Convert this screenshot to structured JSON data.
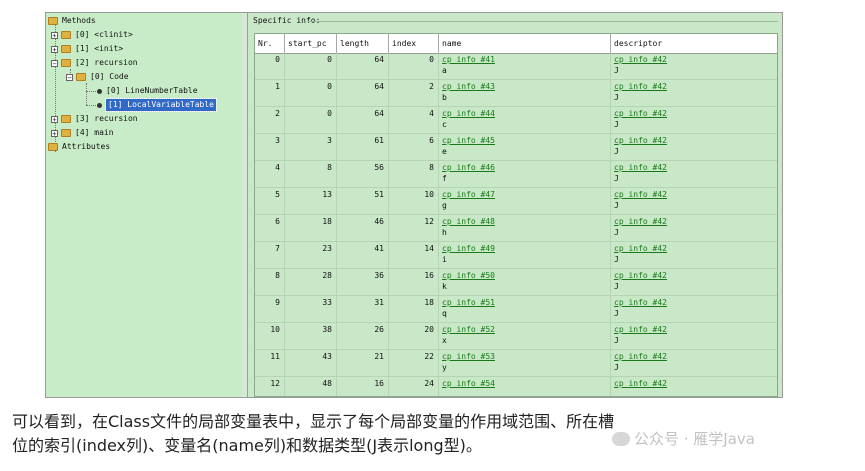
{
  "tree": {
    "methods_label": "Methods",
    "clinit_label": "[0] <clinit>",
    "init_label": "[1] <init>",
    "recursion2_label": "[2] recursion",
    "code_label": "[0] Code",
    "lnt_label": "[0] LineNumberTable",
    "lvt_label": "[1] LocalVariableTable",
    "recursion3_label": "[3] recursion",
    "main_label": "[4] main",
    "attributes_label": "Attributes",
    "collapsed_glyph": "+",
    "expanded_glyph": "−"
  },
  "panel": {
    "title": "Specific info:"
  },
  "table": {
    "columns": [
      "Nr.",
      "start_pc",
      "length",
      "index",
      "name",
      "descriptor"
    ],
    "rows": [
      {
        "nr": "0",
        "start_pc": "0",
        "length": "64",
        "index": "0",
        "name_ref": "cp info #41",
        "name": "a",
        "desc_ref": "cp info #42",
        "desc": "J"
      },
      {
        "nr": "1",
        "start_pc": "0",
        "length": "64",
        "index": "2",
        "name_ref": "cp info #43",
        "name": "b",
        "desc_ref": "cp info #42",
        "desc": "J"
      },
      {
        "nr": "2",
        "start_pc": "0",
        "length": "64",
        "index": "4",
        "name_ref": "cp info #44",
        "name": "c",
        "desc_ref": "cp info #42",
        "desc": "J"
      },
      {
        "nr": "3",
        "start_pc": "3",
        "length": "61",
        "index": "6",
        "name_ref": "cp info #45",
        "name": "e",
        "desc_ref": "cp info #42",
        "desc": "J"
      },
      {
        "nr": "4",
        "start_pc": "8",
        "length": "56",
        "index": "8",
        "name_ref": "cp info #46",
        "name": "f",
        "desc_ref": "cp info #42",
        "desc": "J"
      },
      {
        "nr": "5",
        "start_pc": "13",
        "length": "51",
        "index": "10",
        "name_ref": "cp info #47",
        "name": "g",
        "desc_ref": "cp info #42",
        "desc": "J"
      },
      {
        "nr": "6",
        "start_pc": "18",
        "length": "46",
        "index": "12",
        "name_ref": "cp info #48",
        "name": "h",
        "desc_ref": "cp info #42",
        "desc": "J"
      },
      {
        "nr": "7",
        "start_pc": "23",
        "length": "41",
        "index": "14",
        "name_ref": "cp info #49",
        "name": "i",
        "desc_ref": "cp info #42",
        "desc": "J"
      },
      {
        "nr": "8",
        "start_pc": "28",
        "length": "36",
        "index": "16",
        "name_ref": "cp info #50",
        "name": "k",
        "desc_ref": "cp info #42",
        "desc": "J"
      },
      {
        "nr": "9",
        "start_pc": "33",
        "length": "31",
        "index": "18",
        "name_ref": "cp info #51",
        "name": "q",
        "desc_ref": "cp info #42",
        "desc": "J"
      },
      {
        "nr": "10",
        "start_pc": "38",
        "length": "26",
        "index": "20",
        "name_ref": "cp info #52",
        "name": "x",
        "desc_ref": "cp info #42",
        "desc": "J"
      },
      {
        "nr": "11",
        "start_pc": "43",
        "length": "21",
        "index": "22",
        "name_ref": "cp info #53",
        "name": "y",
        "desc_ref": "cp info #42",
        "desc": "J"
      },
      {
        "nr": "12",
        "start_pc": "48",
        "length": "16",
        "index": "24",
        "name_ref": "cp info #54",
        "name": "",
        "desc_ref": "cp info #42",
        "desc": ""
      }
    ]
  },
  "caption": {
    "line1": "可以看到，在Class文件的局部变量表中，显示了每个局部变量的作用域范围、所在槽",
    "line2": "位的索引(index列)、变量名(name列)和数据类型(J表示long型)。"
  },
  "watermark": {
    "text": "公众号 · 雁学Java"
  },
  "colors": {
    "panel_bg": "#c8e8c8",
    "link": "#1a7a1a",
    "selection": "#3169c6",
    "folder": "#e0b040"
  }
}
